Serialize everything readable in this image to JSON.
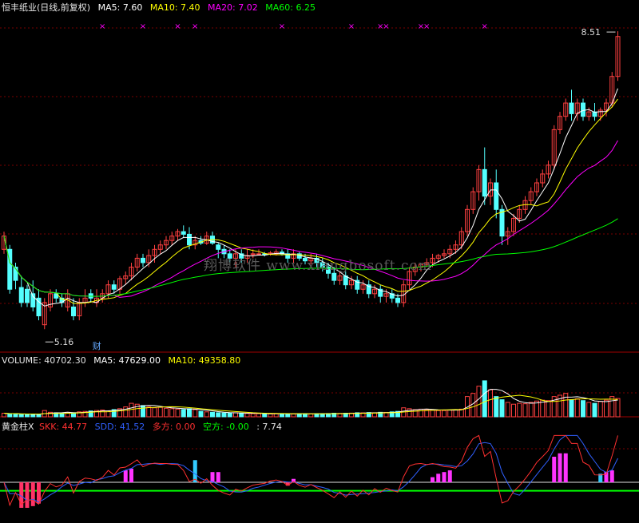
{
  "header": {
    "title": "恒丰纸业(日线,前复权)",
    "ma5_label": "MA5:",
    "ma5_value": "7.60",
    "ma10_label": "MA10:",
    "ma10_value": "7.40",
    "ma20_label": "MA20:",
    "ma20_value": "7.02",
    "ma60_label": "MA60:",
    "ma60_value": "6.25"
  },
  "volume_header": {
    "label": "VOLUME:",
    "value": "40702.30",
    "ma5_label": "MA5:",
    "ma5_value": "47629.00",
    "ma10_label": "MA10:",
    "ma10_value": "49358.80"
  },
  "indicator_header": {
    "name": "黄金柱X",
    "skk_label": "SKK:",
    "skk_value": "44.77",
    "sdd_label": "SDD:",
    "sdd_value": "41.52",
    "duo_label": "多方:",
    "duo_value": "0.00",
    "kong_label": "空方:",
    "kong_value": "-0.00",
    "extra_value": ": 7.74"
  },
  "watermark": "翔博软件 www.xiangbosoft.com",
  "annotations": {
    "high_label": "8.51",
    "low_label": "5.16",
    "finance_marker": "财"
  },
  "colors": {
    "up": "#ff4040",
    "down": "#54ffff",
    "ma5": "#ffffff",
    "ma10": "#ffff00",
    "ma20": "#ff00ff",
    "ma60": "#00ff00",
    "grid": "#7a0000"
  },
  "chart_data": {
    "type": "candlestick",
    "price": {
      "ylim": [
        4.9,
        8.7
      ],
      "candles": [
        [
          6.05,
          6.25,
          6.2,
          6.0
        ],
        [
          6.05,
          6.1,
          5.6,
          5.55
        ],
        [
          5.85,
          5.9,
          5.7,
          5.6
        ],
        [
          5.62,
          5.75,
          5.45,
          5.4
        ],
        [
          5.6,
          5.65,
          5.45,
          5.4
        ],
        [
          5.55,
          5.7,
          5.4,
          5.35
        ],
        [
          5.5,
          5.6,
          5.3,
          5.25
        ],
        [
          5.2,
          5.5,
          5.45,
          5.15
        ],
        [
          5.4,
          5.6,
          5.55,
          5.35
        ],
        [
          5.55,
          5.6,
          5.5,
          5.45
        ],
        [
          5.5,
          5.55,
          5.45,
          5.4
        ],
        [
          5.4,
          5.6,
          5.55,
          5.35
        ],
        [
          5.4,
          5.5,
          5.3,
          5.25
        ],
        [
          5.3,
          5.5,
          5.45,
          5.25
        ],
        [
          5.45,
          5.6,
          5.5,
          5.4
        ],
        [
          5.55,
          5.6,
          5.5,
          5.45
        ],
        [
          5.45,
          5.6,
          5.5,
          5.4
        ],
        [
          5.5,
          5.6,
          5.55,
          5.45
        ],
        [
          5.55,
          5.7,
          5.65,
          5.5
        ],
        [
          5.65,
          5.7,
          5.6,
          5.55
        ],
        [
          5.6,
          5.75,
          5.72,
          5.55
        ],
        [
          5.72,
          5.8,
          5.75,
          5.65
        ],
        [
          5.75,
          5.9,
          5.85,
          5.7
        ],
        [
          5.85,
          6.0,
          5.95,
          5.8
        ],
        [
          5.95,
          6.0,
          5.9,
          5.85
        ],
        [
          5.9,
          6.05,
          5.98,
          5.85
        ],
        [
          5.98,
          6.1,
          6.05,
          5.9
        ],
        [
          6.05,
          6.15,
          6.1,
          6.0
        ],
        [
          6.1,
          6.2,
          6.15,
          6.05
        ],
        [
          6.15,
          6.25,
          6.2,
          6.1
        ],
        [
          6.2,
          6.28,
          6.25,
          6.15
        ],
        [
          6.25,
          6.32,
          6.22,
          6.18
        ],
        [
          6.22,
          6.3,
          6.1,
          6.05
        ],
        [
          6.1,
          6.2,
          6.15,
          6.05
        ],
        [
          6.15,
          6.2,
          6.12,
          6.1
        ],
        [
          6.12,
          6.25,
          6.2,
          6.1
        ],
        [
          6.2,
          6.25,
          6.12,
          6.1
        ],
        [
          6.1,
          6.12,
          6.05,
          5.95
        ],
        [
          6.05,
          6.1,
          6.0,
          5.95
        ],
        [
          6.0,
          6.05,
          5.95,
          5.9
        ],
        [
          5.95,
          6.05,
          6.0,
          5.85
        ],
        [
          6.0,
          6.05,
          5.95,
          5.9
        ],
        [
          5.95,
          6.05,
          5.98,
          5.9
        ],
        [
          6.0,
          6.05,
          6.0,
          5.95
        ],
        [
          6.0,
          6.05,
          6.0,
          5.98
        ],
        [
          6.0,
          6.02,
          5.99,
          5.97
        ],
        [
          6.0,
          6.03,
          6.01,
          5.98
        ],
        [
          6.0,
          6.05,
          6.02,
          5.98
        ],
        [
          6.02,
          6.05,
          6.0,
          5.98
        ],
        [
          6.0,
          6.05,
          5.95,
          5.9
        ],
        [
          5.95,
          6.05,
          6.0,
          5.9
        ],
        [
          6.0,
          6.02,
          5.95,
          5.92
        ],
        [
          5.95,
          6.0,
          5.92,
          5.88
        ],
        [
          5.92,
          6.0,
          5.95,
          5.88
        ],
        [
          5.95,
          6.0,
          5.9,
          5.85
        ],
        [
          5.9,
          5.95,
          5.85,
          5.8
        ],
        [
          5.85,
          5.9,
          5.78,
          5.72
        ],
        [
          5.78,
          5.85,
          5.7,
          5.65
        ],
        [
          5.7,
          5.8,
          5.75,
          5.65
        ],
        [
          5.75,
          5.8,
          5.65,
          5.6
        ],
        [
          5.65,
          5.75,
          5.7,
          5.6
        ],
        [
          5.7,
          5.75,
          5.6,
          5.55
        ],
        [
          5.6,
          5.7,
          5.65,
          5.55
        ],
        [
          5.65,
          5.7,
          5.55,
          5.5
        ],
        [
          5.55,
          5.65,
          5.6,
          5.5
        ],
        [
          5.6,
          5.65,
          5.52,
          5.45
        ],
        [
          5.52,
          5.6,
          5.55,
          5.45
        ],
        [
          5.55,
          5.6,
          5.5,
          5.45
        ],
        [
          5.5,
          5.55,
          5.45,
          5.4
        ],
        [
          5.45,
          5.7,
          5.65,
          5.4
        ],
        [
          5.65,
          5.85,
          5.8,
          5.6
        ],
        [
          5.8,
          5.9,
          5.85,
          5.75
        ],
        [
          5.85,
          5.9,
          5.88,
          5.8
        ],
        [
          5.88,
          5.95,
          5.9,
          5.85
        ],
        [
          5.9,
          6.0,
          5.95,
          5.85
        ],
        [
          5.95,
          6.0,
          5.98,
          5.9
        ],
        [
          5.98,
          6.05,
          6.0,
          5.95
        ],
        [
          6.0,
          6.1,
          6.05,
          5.95
        ],
        [
          6.05,
          6.15,
          6.1,
          6.0
        ],
        [
          6.1,
          6.3,
          6.25,
          6.05
        ],
        [
          6.25,
          6.55,
          6.5,
          6.2
        ],
        [
          6.5,
          6.75,
          6.7,
          6.45
        ],
        [
          6.7,
          7.0,
          6.95,
          6.6
        ],
        [
          6.95,
          7.2,
          6.65,
          6.55
        ],
        [
          6.65,
          6.85,
          6.8,
          6.55
        ],
        [
          6.8,
          6.95,
          6.5,
          6.4
        ],
        [
          6.5,
          6.55,
          6.2,
          6.1
        ],
        [
          6.2,
          6.3,
          6.25,
          6.1
        ],
        [
          6.25,
          6.45,
          6.4,
          6.2
        ],
        [
          6.4,
          6.55,
          6.5,
          6.35
        ],
        [
          6.5,
          6.65,
          6.6,
          6.45
        ],
        [
          6.6,
          6.75,
          6.7,
          6.55
        ],
        [
          6.7,
          6.85,
          6.8,
          6.65
        ],
        [
          6.8,
          6.95,
          6.9,
          6.75
        ],
        [
          6.9,
          7.05,
          7.0,
          6.85
        ],
        [
          7.0,
          7.45,
          7.4,
          6.95
        ],
        [
          7.4,
          7.6,
          7.55,
          7.35
        ],
        [
          7.55,
          7.75,
          7.7,
          7.5
        ],
        [
          7.7,
          7.85,
          7.58,
          7.5
        ],
        [
          7.58,
          7.75,
          7.7,
          7.5
        ],
        [
          7.7,
          7.75,
          7.55,
          7.5
        ],
        [
          7.55,
          7.65,
          7.6,
          7.5
        ],
        [
          7.6,
          7.7,
          7.55,
          7.5
        ],
        [
          7.55,
          7.65,
          7.62,
          7.5
        ],
        [
          7.62,
          7.75,
          7.7,
          7.55
        ],
        [
          7.7,
          8.05,
          8.0,
          7.65
        ],
        [
          8.0,
          8.51,
          8.45,
          7.95
        ]
      ]
    },
    "volume": {
      "ylim": [
        0,
        110000
      ],
      "values": [
        8000,
        6000,
        7000,
        5000,
        5000,
        6000,
        5000,
        14000,
        10000,
        9000,
        8000,
        10000,
        9000,
        11000,
        12000,
        13000,
        14000,
        15000,
        13000,
        16000,
        18000,
        22000,
        30000,
        28000,
        25000,
        22000,
        20000,
        21000,
        19000,
        18000,
        17000,
        16000,
        18000,
        16000,
        12000,
        11000,
        10000,
        9000,
        8500,
        8000,
        9000,
        8000,
        7500,
        7000,
        7000,
        6800,
        6500,
        6600,
        7000,
        6500,
        6200,
        6800,
        7000,
        6500,
        6800,
        7000,
        7200,
        8000,
        7500,
        8000,
        8200,
        9000,
        8800,
        9500,
        9000,
        10000,
        9800,
        11000,
        12000,
        20000,
        18000,
        16000,
        17000,
        16000,
        15000,
        14000,
        14000,
        15000,
        16000,
        17000,
        45000,
        52000,
        68000,
        80000,
        60000,
        45000,
        38000,
        32000,
        28000,
        30000,
        29000,
        32000,
        35000,
        37000,
        36000,
        45000,
        48000,
        52000,
        38000,
        40000,
        36000,
        32000,
        30000,
        34000,
        37000,
        45000,
        40702
      ]
    },
    "indicator": {
      "ylim": [
        -45,
        60
      ],
      "bars": [
        0,
        0,
        0,
        -30,
        -30,
        -28,
        -25,
        0,
        0,
        0,
        0,
        0,
        0,
        0,
        0,
        0,
        0,
        0,
        0,
        0,
        0,
        14,
        16,
        0,
        0,
        0,
        0,
        0,
        0,
        0,
        0,
        0,
        0,
        26,
        0,
        0,
        12,
        12,
        0,
        0,
        0,
        0,
        0,
        0,
        0,
        0,
        0,
        0,
        0,
        -4,
        4,
        0,
        0,
        0,
        0,
        0,
        0,
        0,
        0,
        0,
        0,
        0,
        0,
        0,
        0,
        0,
        0,
        0,
        0,
        0,
        0,
        0,
        0,
        0,
        6,
        10,
        12,
        14,
        0,
        0,
        0,
        0,
        0,
        0,
        0,
        0,
        0,
        0,
        0,
        0,
        0,
        0,
        0,
        0,
        0,
        30,
        34,
        34,
        0,
        0,
        0,
        0,
        0,
        10,
        12,
        14,
        0,
        0,
        0,
        0,
        0,
        42,
        50,
        48,
        30,
        34,
        30,
        20,
        0,
        0,
        0,
        0,
        20,
        58
      ]
    }
  }
}
